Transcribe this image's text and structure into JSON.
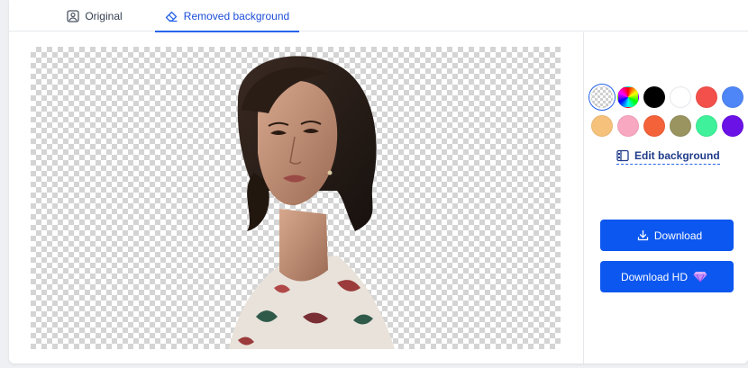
{
  "tabs": {
    "original": "Original",
    "removed": "Removed background"
  },
  "swatches": [
    {
      "name": "transparent",
      "color": "transparent"
    },
    {
      "name": "rainbow",
      "color": "multicolor"
    },
    {
      "name": "black",
      "color": "#000000"
    },
    {
      "name": "white",
      "color": "#ffffff"
    },
    {
      "name": "red",
      "color": "#f4504b"
    },
    {
      "name": "blue",
      "color": "#4f86f7"
    },
    {
      "name": "peach",
      "color": "#f6c27b"
    },
    {
      "name": "pink",
      "color": "#f9a8c2"
    },
    {
      "name": "orange",
      "color": "#f4623a"
    },
    {
      "name": "olive",
      "color": "#9a9461"
    },
    {
      "name": "mint",
      "color": "#3ef19a"
    },
    {
      "name": "purple",
      "color": "#6b12e6"
    }
  ],
  "panel": {
    "edit_background": "Edit background",
    "download": "Download",
    "download_hd": "Download HD"
  },
  "colors": {
    "accent": "#2563eb",
    "button": "#0b57f0"
  }
}
